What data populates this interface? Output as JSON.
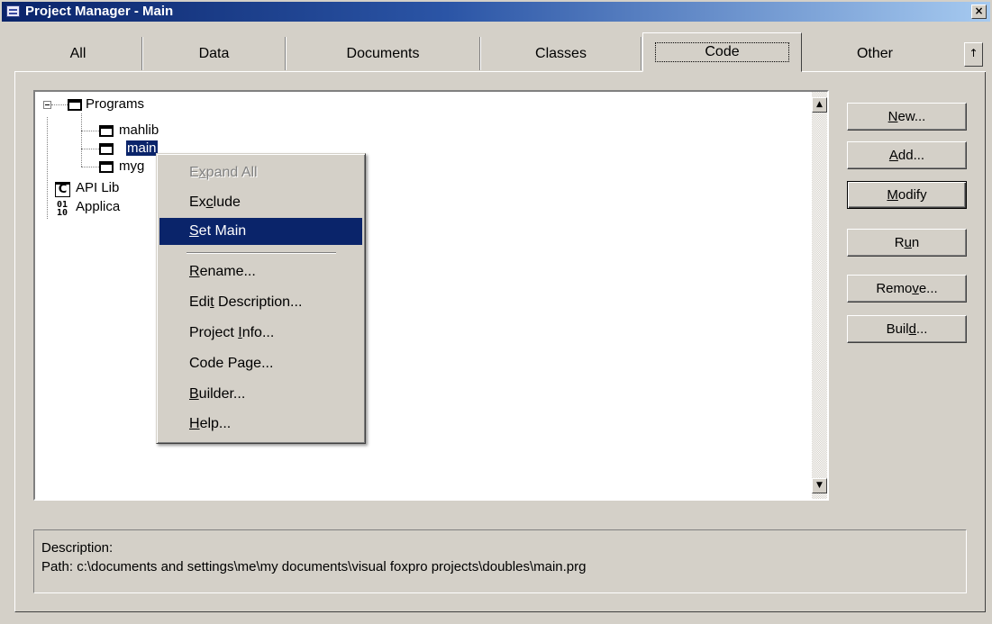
{
  "window": {
    "title": "Project Manager - Main",
    "close_glyph": "×"
  },
  "tabs": [
    {
      "label": "All"
    },
    {
      "label": "Data"
    },
    {
      "label": "Documents"
    },
    {
      "label": "Classes"
    },
    {
      "label": "Code",
      "active": true
    },
    {
      "label": "Other"
    }
  ],
  "tab_scroll_glyph": "↑",
  "tree": {
    "root": "Programs",
    "programs": [
      "mahlib",
      "main",
      "myg"
    ],
    "selected": "main",
    "api": "API Lib",
    "app": "Applica",
    "app_icon_top": "01",
    "app_icon_bottom": "10",
    "api_icon": "C"
  },
  "scrollbar": {
    "up_glyph": "▲",
    "down_glyph": "▼"
  },
  "buttons": [
    {
      "before": "",
      "key": "N",
      "after": "ew..."
    },
    {
      "before": "",
      "key": "A",
      "after": "dd..."
    },
    {
      "before": "",
      "key": "M",
      "after": "odify",
      "default": true
    },
    {
      "before": "R",
      "key": "u",
      "after": "n"
    },
    {
      "before": "Remo",
      "key": "v",
      "after": "e..."
    },
    {
      "before": "Buil",
      "key": "d",
      "after": "..."
    }
  ],
  "description": {
    "label": "Description:",
    "path": "Path: c:\\documents and settings\\me\\my documents\\visual foxpro projects\\doubles\\main.prg"
  },
  "context_menu": [
    {
      "before": "E",
      "key": "x",
      "after": "pand All",
      "disabled": true
    },
    {
      "before": "Ex",
      "key": "c",
      "after": "lude"
    },
    {
      "before": "",
      "key": "S",
      "after": "et Main",
      "highlighted": true
    },
    {
      "before": "",
      "key": "R",
      "after": "ename..."
    },
    {
      "before": "Edi",
      "key": "t",
      "after": " Description..."
    },
    {
      "before": "Project ",
      "key": "I",
      "after": "nfo..."
    },
    {
      "before": "Code Pa",
      "key": "g",
      "after": "e..."
    },
    {
      "before": "",
      "key": "B",
      "after": "uilder..."
    },
    {
      "before": "",
      "key": "H",
      "after": "elp..."
    }
  ]
}
